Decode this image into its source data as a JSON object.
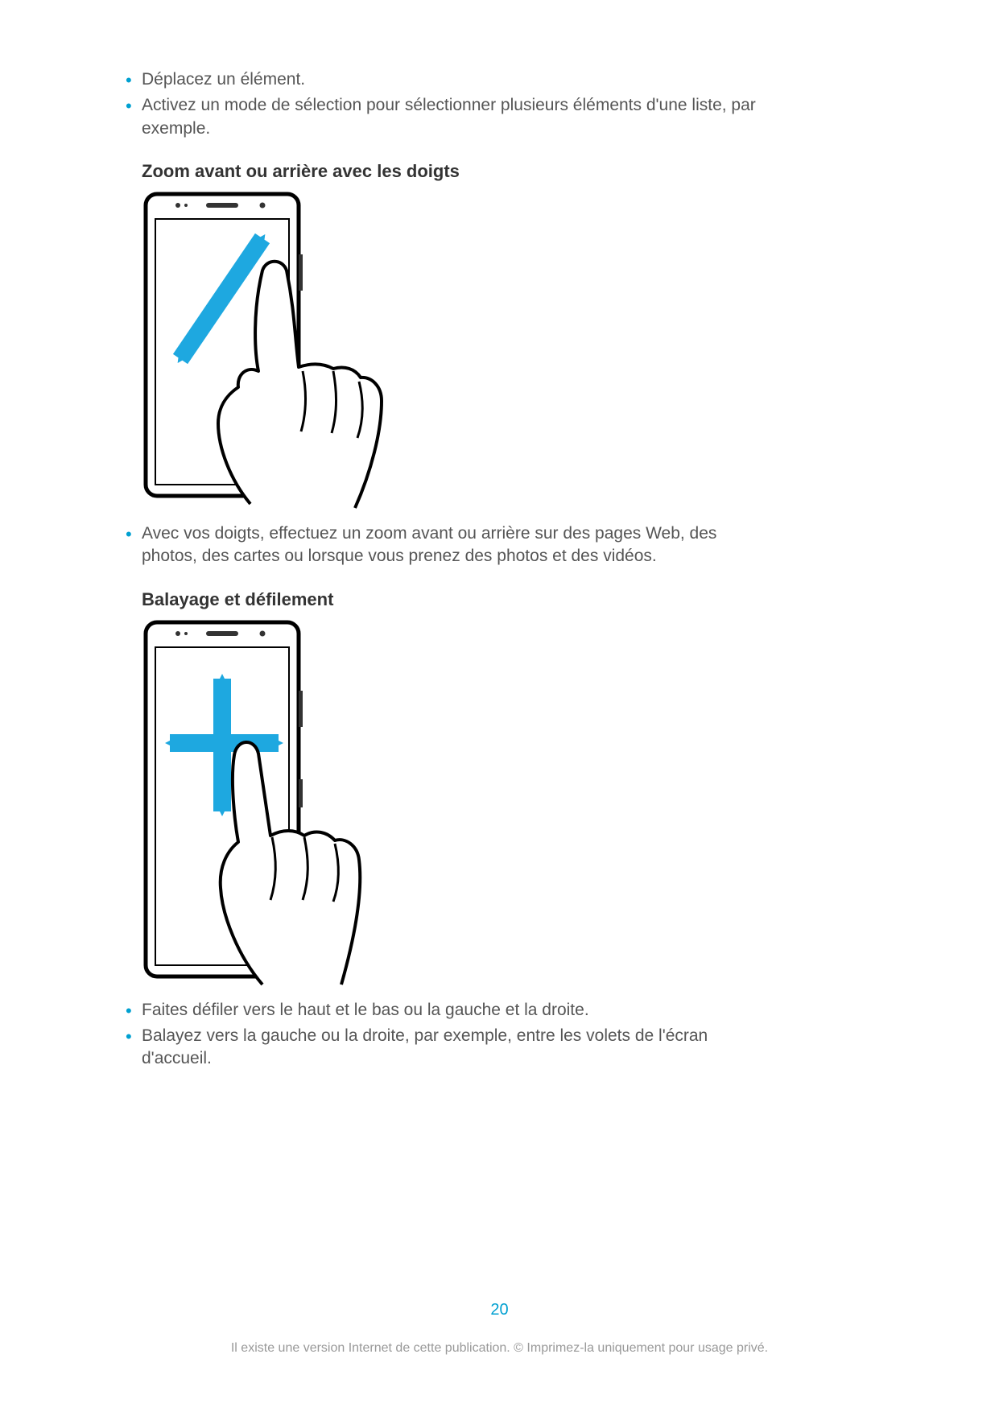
{
  "bullets_top": [
    "Déplacez un élément.",
    "Activez un mode de sélection pour sélectionner plusieurs éléments d'une liste, par exemple."
  ],
  "section1": {
    "heading": "Zoom avant ou arrière avec les doigts",
    "bullets": [
      "Avec vos doigts, effectuez un zoom avant ou arrière sur des pages Web, des photos, des cartes ou lorsque vous prenez des photos et des vidéos."
    ]
  },
  "section2": {
    "heading": "Balayage et défilement",
    "bullets": [
      "Faites défiler vers le haut et le bas ou la gauche et la droite.",
      "Balayez vers la gauche ou la droite, par exemple, entre les volets de l'écran d'accueil."
    ]
  },
  "page_number": "20",
  "footer": "Il existe une version Internet de cette publication. © Imprimez-la uniquement pour usage privé."
}
